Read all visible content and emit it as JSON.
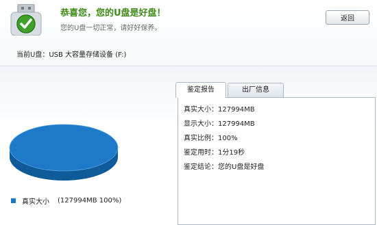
{
  "header": {
    "title": "恭喜您，您的U盘是好盘！",
    "subtitle": "您的U盘一切正常，请好好保养。",
    "back_label": "返回",
    "drive_label": "当前U盘：USB 大容量存储设备 (F:)"
  },
  "tabs": [
    {
      "label": "鉴定报告",
      "active": true
    },
    {
      "label": "出厂信息",
      "active": false
    }
  ],
  "report": [
    "真实大小：127994MB",
    "显示大小：127994MB",
    "真实比例：100%",
    "鉴定用时：1分19秒",
    "鉴定结论：您的U盘是好盘"
  ],
  "chart_data": {
    "type": "pie",
    "labels": [
      "真实大小"
    ],
    "values": [
      127994
    ],
    "percentages": [
      100
    ],
    "legend": [
      {
        "label": "真实大小",
        "value": "(127994MB 100%)"
      }
    ],
    "colors": [
      "#1f79c9"
    ]
  },
  "colors": {
    "title": "#3f8a16",
    "pie": "#1f79c9",
    "pie_side": "#0f5a99"
  }
}
